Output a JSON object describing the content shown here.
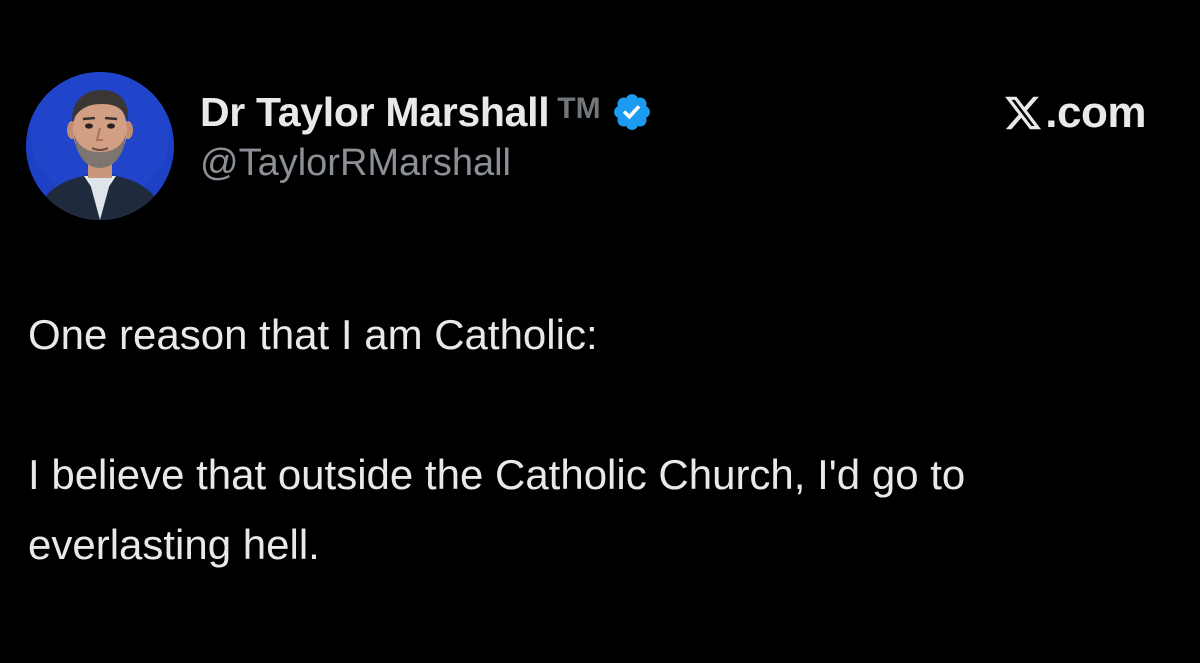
{
  "tweet": {
    "author": {
      "display_name": "Dr Taylor Marshall",
      "trademark": "TM",
      "handle": "@TaylorRMarshall",
      "verified": true,
      "avatar_icon": "profile-photo"
    },
    "brand": {
      "logo_icon": "x-logo-icon",
      "text": ".com"
    },
    "paragraphs": [
      "One reason that I am Catholic:",
      "I believe that outside the Catholic Church, I'd go to everlasting hell."
    ]
  },
  "colors": {
    "background": "#000000",
    "text_primary": "#e7e9ea",
    "text_secondary": "#8b9096",
    "verified_badge": "#1d9bf0",
    "avatar_background": "#1a3bb8"
  }
}
